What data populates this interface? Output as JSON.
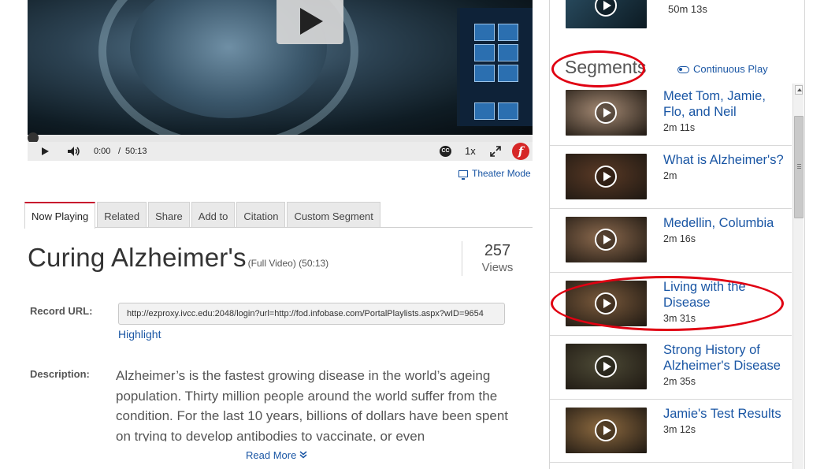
{
  "player": {
    "current_time": "0:00",
    "separator": "/",
    "duration": "50:13",
    "speed": "1x",
    "cc_label": "CC",
    "brand_letter": "f",
    "theater_mode_label": "Theater Mode"
  },
  "tabs": [
    "Now Playing",
    "Related",
    "Share",
    "Add to",
    "Citation",
    "Custom Segment"
  ],
  "video": {
    "title": "Curing Alzheimer's",
    "subtitle": "(Full Video) (50:13)",
    "views_count": "257",
    "views_label": "Views"
  },
  "record": {
    "label": "Record URL:",
    "url": "http://ezproxy.ivcc.edu:2048/login?url=http://fod.infobase.com/PortalPlaylists.aspx?wID=9654",
    "highlight_label": "Highlight"
  },
  "description": {
    "label": "Description:",
    "text": "Alzheimer’s is the fastest growing disease in the world’s ageing population. Thirty million people around the world suffer from the condition. For the last 10 years, billions of dollars have been spent on trying to develop antibodies to vaccinate, or even",
    "read_more": "Read More"
  },
  "panel": {
    "top_item_duration": "50m 13s",
    "segments_title": "Segments",
    "continuous_play": "Continuous Play",
    "segments": [
      {
        "title": "Meet Tom, Jamie, Flo, and Neil",
        "duration": "2m 11s",
        "thumb_color": "#a58a74"
      },
      {
        "title": "What is Alzheimer's?",
        "duration": "2m",
        "thumb_color": "#5a3a26"
      },
      {
        "title": "Medellin, Columbia",
        "duration": "2m 16s",
        "thumb_color": "#8c6a4e"
      },
      {
        "title": "Living with the Disease",
        "duration": "3m 31s",
        "thumb_color": "#7a5a3c"
      },
      {
        "title": "Strong History of Alzheimer's Disease",
        "duration": "2m 35s",
        "thumb_color": "#4d4a36"
      },
      {
        "title": "Jamie's Test Results",
        "duration": "3m 12s",
        "thumb_color": "#8d6a40"
      }
    ]
  }
}
